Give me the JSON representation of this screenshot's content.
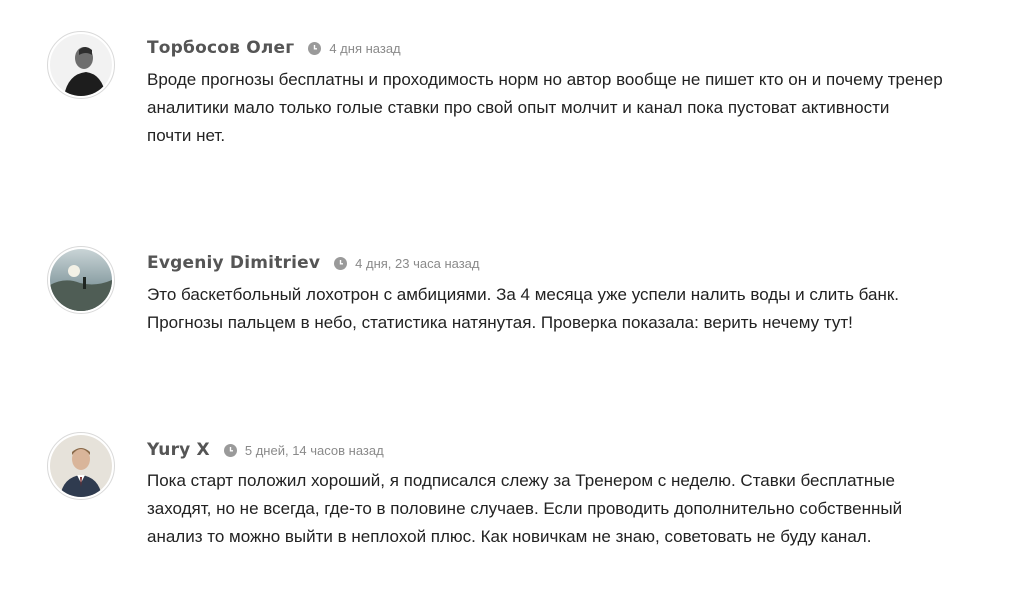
{
  "comments": [
    {
      "author": "Торбосов Олег",
      "time": "4 дня назад",
      "avatar_icon": "user-avatar-icon",
      "lines": [
        "Вроде прогнозы бесплатны и проходимость норм но автор вообще не пишет кто он и почему тренер",
        "аналитики мало только голые ставки про свой опыт молчит и канал пока пустоват активности",
        "почти нет."
      ]
    },
    {
      "author": "Evgeniy Dimitriev",
      "time": "4 дня, 23 часа назад",
      "avatar_icon": "user-avatar-icon",
      "lines": [
        "Это баскетбольный лохотрон с амбициями. За 4 месяца уже успели налить воды и слить банк.",
        "Прогнозы пальцем в небо, статистика натянутая. Проверка показала: верить нечему тут!"
      ]
    },
    {
      "author": "Yury X",
      "time": "5 дней, 14 часов назад",
      "avatar_icon": "user-avatar-icon",
      "lines": [
        "Пока старт положил хороший, я подписался слежу за Тренером с неделю. Ставки бесплатные",
        "заходят, но не всегда, где-то в половине случаев. Если проводить дополнительно собственный",
        "анализ то можно выйти в неплохой плюс. Как новичкам не знаю, советовать не буду канал."
      ]
    }
  ],
  "colors": {
    "author": "#555555",
    "time": "#8a8a8a",
    "text": "#222222",
    "clock": "#9a9a9a"
  }
}
